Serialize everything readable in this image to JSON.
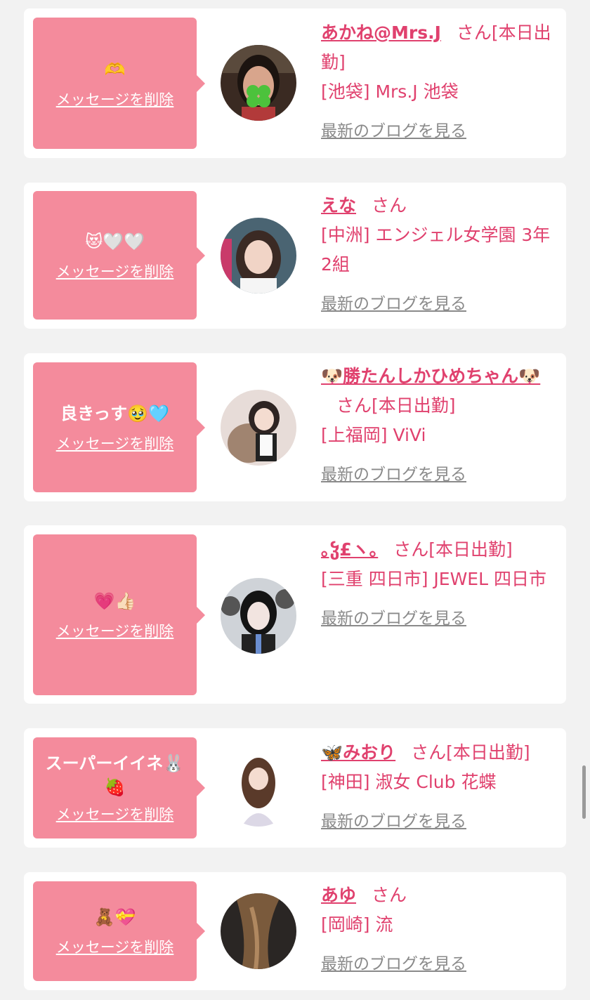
{
  "delete_label": "メッセージを削除",
  "blog_label": "最新のブログを見る",
  "san_label": "さん",
  "colors": {
    "accent": "#e0416e",
    "bubble": "#f48b9c",
    "link_gray": "#8a8a8a",
    "background": "#f2f2f2"
  },
  "messages": [
    {
      "bubble_text": "🫶",
      "name": "あかね@Mrs.J",
      "status": "[本日出勤]",
      "shop": "[池袋] Mrs.J 池袋",
      "avatar_icon": "clover-avatar"
    },
    {
      "bubble_text": "😻🤍🤍",
      "name": "えな",
      "status": "",
      "shop": "[中洲] エンジェル女学園 3年2組",
      "avatar_icon": "girl-avatar"
    },
    {
      "bubble_text": "良きっす🥹🩵",
      "name": "🐶勝たんしかひめちゃん🐶",
      "status": "[本日出勤]",
      "shop": "[上福岡] ViVi",
      "avatar_icon": "girl-avatar"
    },
    {
      "bubble_text": "💗👍🏻",
      "name": "｡ჴ£ヽ｡",
      "status": "[本日出勤]",
      "shop": "[三重 四日市] JEWEL 四日市",
      "avatar_icon": "girl-avatar"
    },
    {
      "bubble_text": "スーパーイイネ🐰🍓",
      "name": "🦋みおり",
      "status": "[本日出勤]",
      "shop": "[神田] 淑女 Club 花蝶",
      "avatar_icon": "girl-avatar"
    },
    {
      "bubble_text": "🧸💝",
      "name": "あゆ",
      "status": "",
      "shop": "[岡崎] 流",
      "avatar_icon": "hair-avatar"
    }
  ]
}
